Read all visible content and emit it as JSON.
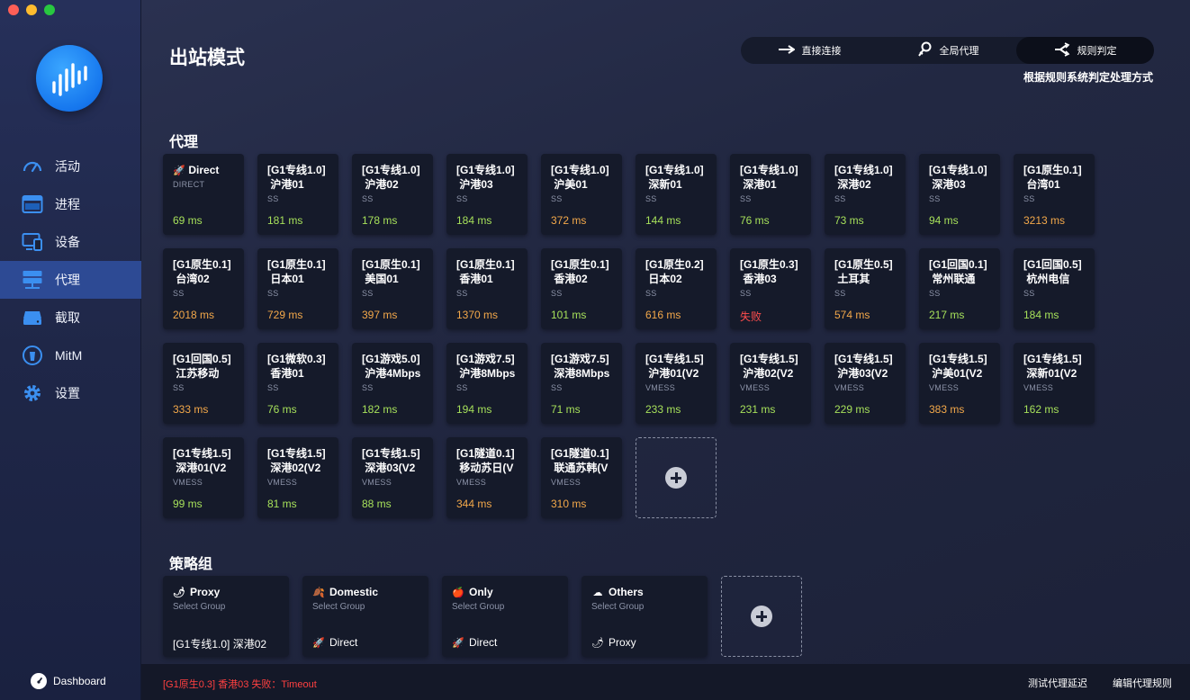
{
  "window": {
    "title": ""
  },
  "sidebar": {
    "items": [
      {
        "label": "活动",
        "icon": "speedometer-icon"
      },
      {
        "label": "进程",
        "icon": "window-icon"
      },
      {
        "label": "设备",
        "icon": "devices-icon"
      },
      {
        "label": "代理",
        "icon": "server-icon",
        "active": true
      },
      {
        "label": "截取",
        "icon": "drive-icon"
      },
      {
        "label": "MitM",
        "icon": "lock-icon"
      },
      {
        "label": "设置",
        "icon": "gear-icon"
      }
    ],
    "dashboard_label": "Dashboard"
  },
  "header": {
    "title": "出站模式",
    "modes": [
      {
        "label": "直接连接",
        "icon": "arrow-right-icon"
      },
      {
        "label": "全局代理",
        "icon": "globe-key-icon"
      },
      {
        "label": "规则判定",
        "icon": "split-arrows-icon",
        "active": true
      }
    ],
    "mode_description": "根据规则系统判定处理方式"
  },
  "proxies_section": {
    "title": "代理"
  },
  "proxies": [
    {
      "line1": "Direct",
      "line2": "",
      "type": "DIRECT",
      "latency": "69 ms",
      "status": "green",
      "emoji": "🚀"
    },
    {
      "line1": "[G1专线1.0]",
      "line2": " 沪港01",
      "type": "SS",
      "latency": "181 ms",
      "status": "green"
    },
    {
      "line1": "[G1专线1.0]",
      "line2": " 沪港02",
      "type": "SS",
      "latency": "178 ms",
      "status": "green"
    },
    {
      "line1": "[G1专线1.0]",
      "line2": " 沪港03",
      "type": "SS",
      "latency": "184 ms",
      "status": "green"
    },
    {
      "line1": "[G1专线1.0]",
      "line2": " 沪美01",
      "type": "SS",
      "latency": "372 ms",
      "status": "orange"
    },
    {
      "line1": "[G1专线1.0]",
      "line2": " 深新01",
      "type": "SS",
      "latency": "144 ms",
      "status": "green"
    },
    {
      "line1": "[G1专线1.0]",
      "line2": " 深港01",
      "type": "SS",
      "latency": "76 ms",
      "status": "green"
    },
    {
      "line1": "[G1专线1.0]",
      "line2": " 深港02",
      "type": "SS",
      "latency": "73 ms",
      "status": "green"
    },
    {
      "line1": "[G1专线1.0]",
      "line2": " 深港03",
      "type": "SS",
      "latency": "94 ms",
      "status": "green"
    },
    {
      "line1": "[G1原生0.1]",
      "line2": " 台湾01",
      "type": "SS",
      "latency": "3213 ms",
      "status": "orange"
    },
    {
      "line1": "[G1原生0.1]",
      "line2": " 台湾02",
      "type": "SS",
      "latency": "2018 ms",
      "status": "orange"
    },
    {
      "line1": "[G1原生0.1]",
      "line2": " 日本01",
      "type": "SS",
      "latency": "729 ms",
      "status": "orange"
    },
    {
      "line1": "[G1原生0.1]",
      "line2": " 美国01",
      "type": "SS",
      "latency": "397 ms",
      "status": "orange"
    },
    {
      "line1": "[G1原生0.1]",
      "line2": " 香港01",
      "type": "SS",
      "latency": "1370 ms",
      "status": "orange"
    },
    {
      "line1": "[G1原生0.1]",
      "line2": " 香港02",
      "type": "SS",
      "latency": "101 ms",
      "status": "green"
    },
    {
      "line1": "[G1原生0.2]",
      "line2": " 日本02",
      "type": "SS",
      "latency": "616 ms",
      "status": "orange"
    },
    {
      "line1": "[G1原生0.3]",
      "line2": " 香港03",
      "type": "SS",
      "latency": "失败",
      "status": "red"
    },
    {
      "line1": "[G1原生0.5]",
      "line2": " 土耳其",
      "type": "SS",
      "latency": "574 ms",
      "status": "orange"
    },
    {
      "line1": "[G1回国0.1]",
      "line2": " 常州联通",
      "type": "SS",
      "latency": "217 ms",
      "status": "green"
    },
    {
      "line1": "[G1回国0.5]",
      "line2": " 杭州电信",
      "type": "SS",
      "latency": "184 ms",
      "status": "green"
    },
    {
      "line1": "[G1回国0.5]",
      "line2": " 江苏移动",
      "type": "SS",
      "latency": "333 ms",
      "status": "orange"
    },
    {
      "line1": "[G1微软0.3]",
      "line2": " 香港01",
      "type": "SS",
      "latency": "76 ms",
      "status": "green"
    },
    {
      "line1": "[G1游戏5.0]",
      "line2": " 沪港4Mbps",
      "type": "SS",
      "latency": "182 ms",
      "status": "green"
    },
    {
      "line1": "[G1游戏7.5]",
      "line2": " 沪港8Mbps",
      "type": "SS",
      "latency": "194 ms",
      "status": "green"
    },
    {
      "line1": "[G1游戏7.5]",
      "line2": " 深港8Mbps",
      "type": "SS",
      "latency": "71 ms",
      "status": "green"
    },
    {
      "line1": "[G1专线1.5]",
      "line2": " 沪港01(V2",
      "type": "VMESS",
      "latency": "233 ms",
      "status": "green"
    },
    {
      "line1": "[G1专线1.5]",
      "line2": " 沪港02(V2",
      "type": "VMESS",
      "latency": "231 ms",
      "status": "green"
    },
    {
      "line1": "[G1专线1.5]",
      "line2": " 沪港03(V2",
      "type": "VMESS",
      "latency": "229 ms",
      "status": "green"
    },
    {
      "line1": "[G1专线1.5]",
      "line2": " 沪美01(V2",
      "type": "VMESS",
      "latency": "383 ms",
      "status": "orange"
    },
    {
      "line1": "[G1专线1.5]",
      "line2": " 深新01(V2",
      "type": "VMESS",
      "latency": "162 ms",
      "status": "green"
    },
    {
      "line1": "[G1专线1.5]",
      "line2": " 深港01(V2",
      "type": "VMESS",
      "latency": "99 ms",
      "status": "green"
    },
    {
      "line1": "[G1专线1.5]",
      "line2": " 深港02(V2",
      "type": "VMESS",
      "latency": "81 ms",
      "status": "green"
    },
    {
      "line1": "[G1专线1.5]",
      "line2": " 深港03(V2",
      "type": "VMESS",
      "latency": "88 ms",
      "status": "green"
    },
    {
      "line1": "[G1隧道0.1]",
      "line2": " 移动苏日(V",
      "type": "VMESS",
      "latency": "344 ms",
      "status": "orange"
    },
    {
      "line1": "[G1隧道0.1]",
      "line2": " 联通苏韩(V",
      "type": "VMESS",
      "latency": "310 ms",
      "status": "orange"
    }
  ],
  "groups_section": {
    "title": "策略组"
  },
  "groups": [
    {
      "name": "Proxy",
      "emoji": "🌶",
      "type": "Select Group",
      "selected": "[G1专线1.0] 深港02",
      "selected_emoji": ""
    },
    {
      "name": "Domestic",
      "emoji": "🍂",
      "type": "Select Group",
      "selected": "Direct",
      "selected_emoji": "🚀"
    },
    {
      "name": "Only",
      "emoji": "🍎",
      "type": "Select Group",
      "selected": "Direct",
      "selected_emoji": "🚀"
    },
    {
      "name": "Others",
      "emoji": "☁",
      "type": "Select Group",
      "selected": "Proxy",
      "selected_emoji": "🌶"
    }
  ],
  "footer": {
    "status_message": "[G1原生0.3] 香港03 失败：Timeout",
    "test_button": "测试代理延迟",
    "edit_button": "编辑代理规则"
  },
  "colors": {
    "accent": "#2d4a94",
    "latency_ok": "#a6e05a",
    "latency_slow": "#f3a84a",
    "latency_fail": "#ff4d4d"
  }
}
